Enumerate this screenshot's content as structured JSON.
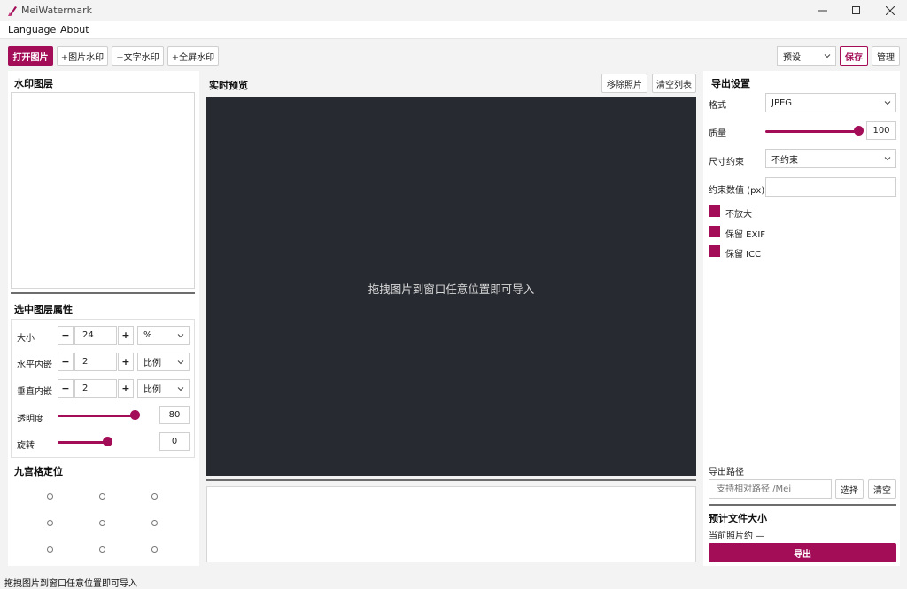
{
  "window": {
    "title": "MeiWatermark"
  },
  "menu": {
    "language": "Language",
    "about": "About"
  },
  "toolbar": {
    "open_image": "打开图片",
    "image_watermark": "+图片水印",
    "text_watermark": "+文字水印",
    "fullscreen_watermark": "+全屏水印",
    "preset_value": "预设",
    "save": "保存",
    "manage": "管理"
  },
  "left": {
    "layers_title": "水印图层",
    "props_title": "选中图层属性",
    "size_label": "大小",
    "size_value": "24",
    "size_unit": "%",
    "hinset_label": "水平内嵌",
    "hinset_value": "2",
    "hinset_unit": "比例",
    "vinset_label": "垂直内嵌",
    "vinset_value": "2",
    "vinset_unit": "比例",
    "opacity_label": "透明度",
    "opacity_value": "80",
    "rotation_label": "旋转",
    "rotation_value": "0",
    "grid_title": "九宫格定位",
    "minus": "−",
    "plus": "+"
  },
  "center": {
    "preview_title": "实时预览",
    "remove_photo": "移除照片",
    "clear_list": "清空列表",
    "drop_hint": "拖拽图片到窗口任意位置即可导入"
  },
  "right": {
    "export_title": "导出设置",
    "format_label": "格式",
    "format_value": "JPEG",
    "quality_label": "质量",
    "quality_value": "100",
    "size_constraint_label": "尺寸约束",
    "size_constraint_value": "不约束",
    "constraint_value_label": "约束数值 (px)",
    "constraint_value": "",
    "no_upscale": "不放大",
    "keep_exif": "保留 EXIF",
    "keep_icc": "保留 ICC",
    "export_path_label": "导出路径",
    "export_path_placeholder": "支持相对路径 /Mei",
    "choose": "选择",
    "clear": "清空",
    "est_size_title": "预计文件大小",
    "current_photo": "当前照片约 —",
    "export": "导出"
  },
  "status": {
    "text": "拖拽图片到窗口任意位置即可导入"
  },
  "colors": {
    "accent": "#a30d58",
    "preview_bg": "#272a31"
  }
}
